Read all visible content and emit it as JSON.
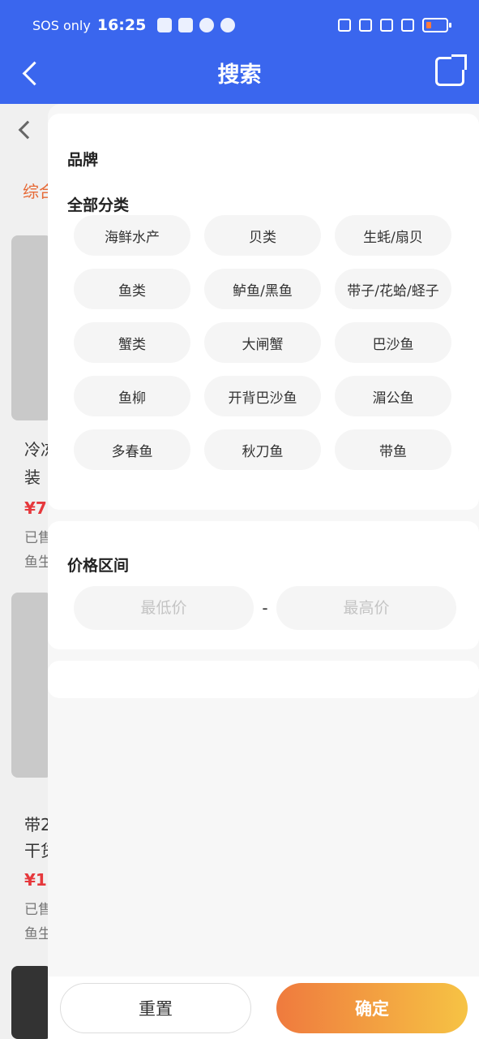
{
  "status_bar": {
    "carrier": "SOS only",
    "time": "16:25"
  },
  "header": {
    "title": "搜索"
  },
  "background_page": {
    "tab_label": "综合",
    "item1_title_line1": "冷冻",
    "item1_title_line2": "装",
    "item1_price": "¥7",
    "item1_sold": "已售",
    "item1_shop": "鱼生",
    "item2_title_line1": "带2",
    "item2_title_line2": "干货",
    "item2_price": "¥1",
    "item2_sold": "已售",
    "item2_shop": "鱼生"
  },
  "filter": {
    "brand_title": "品牌",
    "category_title": "全部分类",
    "categories": [
      "海鲜水产",
      "贝类",
      "生蚝/扇贝",
      "鱼类",
      "鲈鱼/黑鱼",
      "带子/花蛤/蛏子",
      "蟹类",
      "大闸蟹",
      "巴沙鱼",
      "鱼柳",
      "开背巴沙鱼",
      "湄公鱼",
      "多春鱼",
      "秋刀鱼",
      "带鱼"
    ],
    "price_title": "价格区间",
    "price_min_placeholder": "最低价",
    "price_separator": "-",
    "price_max_placeholder": "最高价"
  },
  "footer": {
    "reset_label": "重置",
    "confirm_label": "确定"
  },
  "colors": {
    "header_bg": "#3a66ee",
    "accent_start": "#ef7a3e",
    "accent_end": "#f6c344"
  }
}
